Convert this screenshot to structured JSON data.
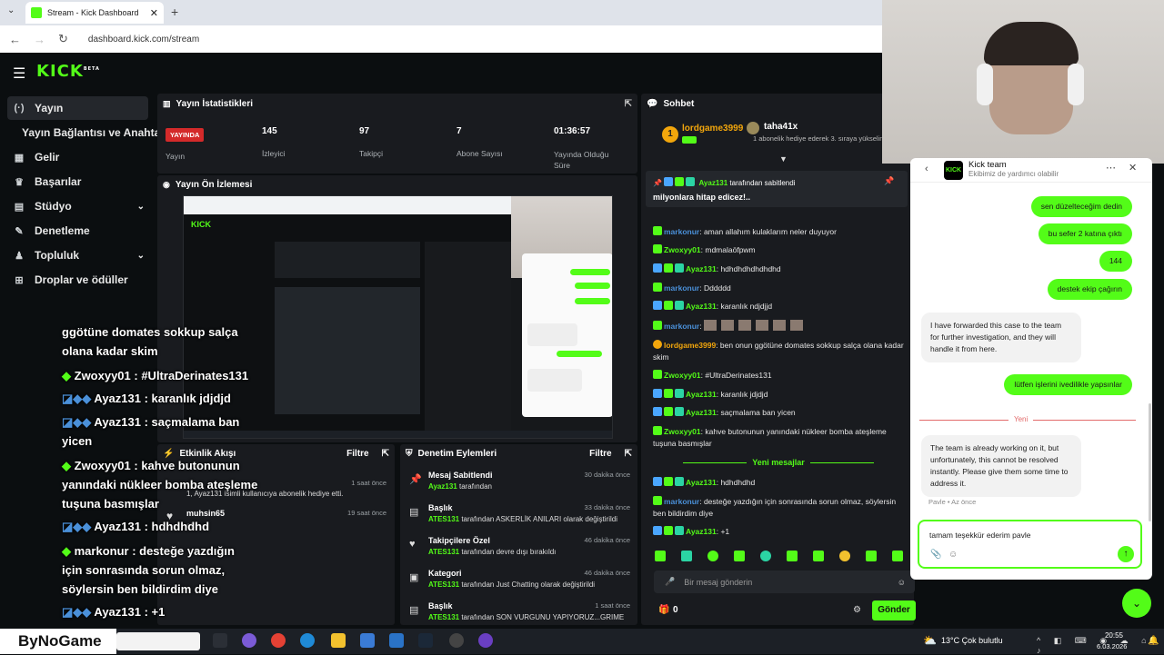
{
  "browser": {
    "tab_title": "Stream - Kick Dashboard",
    "url": "dashboard.kick.com/stream"
  },
  "app": {
    "logo": "KICK",
    "logo_sup": "BETA",
    "nav": [
      {
        "label": "Yayın",
        "icon": "stream-icon",
        "active": true
      },
      {
        "label": "Yayın Bağlantısı ve Anahtarı",
        "icon": ""
      },
      {
        "label": "Gelir",
        "icon": "revenue-icon"
      },
      {
        "label": "Başarılar",
        "icon": "trophy-icon"
      },
      {
        "label": "Stüdyo",
        "icon": "studio-icon",
        "chevron": true
      },
      {
        "label": "Denetleme",
        "icon": "wrench-icon"
      },
      {
        "label": "Topluluk",
        "icon": "community-icon",
        "chevron": true
      },
      {
        "label": "Droplar ve ödüller",
        "icon": "drops-icon"
      }
    ]
  },
  "stats": {
    "title": "Yayın İstatistikleri",
    "live_badge": "YAYINDA",
    "items": [
      {
        "value": "",
        "label": "Yayın"
      },
      {
        "value": "145",
        "label": "İzleyici"
      },
      {
        "value": "97",
        "label": "Takipçi"
      },
      {
        "value": "7",
        "label": "Abone Sayısı"
      },
      {
        "value": "01:36:57",
        "label": "Yayında Olduğu Süre"
      }
    ]
  },
  "preview": {
    "title": "Yayın Ön İzlemesi"
  },
  "activity": {
    "title": "Etkinlik Akışı",
    "filter": "Filtre",
    "items": [
      {
        "text": "1, Ayaz131 isimli kullanıcıya abonelik hediye etti.",
        "time": "1 saat önce"
      },
      {
        "user": "muhsin65",
        "text": "etti",
        "time": "19 saat önce"
      }
    ]
  },
  "modlog": {
    "title": "Denetim Eylemleri",
    "filter": "Filtre",
    "items": [
      {
        "title": "Mesaj Sabitlendi",
        "by": "Ayaz131",
        "rest": "tarafından",
        "time": "30 dakika önce"
      },
      {
        "title": "Başlık",
        "by": "ATES131",
        "rest": "tarafından ASKERLİK ANILARI olarak değiştirildi",
        "time": "33 dakika önce"
      },
      {
        "title": "Takipçilere Özel",
        "by": "ATES131",
        "rest": "tarafından devre dışı bırakıldı",
        "time": "46 dakika önce"
      },
      {
        "title": "Kategori",
        "by": "ATES131",
        "rest": "tarafından Just Chatting olarak değiştirildi",
        "time": "46 dakika önce"
      },
      {
        "title": "Başlık",
        "by": "ATES131",
        "rest": "tarafından SON VURGUNU YAPIYORUZ...GRIME",
        "time": "1 saat önce"
      }
    ]
  },
  "chat": {
    "title": "Sohbet",
    "top_gifter_1": "lordgame3999",
    "top_gifter_2": "taha41x",
    "top_gifter_2_note": "1 abonelik hediye ederek 3. sıraya yükselin",
    "pinned_by": "Ayaz131",
    "pinned_note": "tarafından sabitlendi",
    "pinned_msg": "milyonlara hitap edicez!..",
    "messages": [
      {
        "user": "markonur",
        "text": "aman allahım kulaklarım neler duyuyor"
      },
      {
        "user": "Zwoxyy01",
        "text": "mdmalaöfpwm"
      },
      {
        "user": "Ayaz131",
        "text": "hdhdhdhdhdhdhd"
      },
      {
        "user": "markonur",
        "text": "Dddddd"
      },
      {
        "user": "Ayaz131",
        "text": "karanlık ndjdjjd"
      },
      {
        "user": "markonur",
        "text": ""
      },
      {
        "user": "lordgame3999",
        "text": "ben onun ggötüne domates sokkup salça olana kadar skim"
      },
      {
        "user": "Zwoxyy01",
        "text": "#UltraDerinates131"
      },
      {
        "user": "Ayaz131",
        "text": "karanlık jdjdjd"
      },
      {
        "user": "Ayaz131",
        "text": "saçmalama ban yicen"
      },
      {
        "user": "Zwoxyy01",
        "text": "kahve butonunun yanındaki nükleer bomba ateşleme tuşuna basmışlar"
      },
      {
        "user": "Ayaz131",
        "text": "hdhdhdhd"
      },
      {
        "user": "markonur",
        "text": "desteğe yazdığın için sonrasında sorun olmaz, söylersin ben bildirdim diye"
      },
      {
        "user": "Ayaz131",
        "text": "+1"
      }
    ],
    "new_messages": "Yeni mesajlar",
    "input_placeholder": "Bir mesaj gönderin",
    "points": "0",
    "send": "Gönder"
  },
  "overlay": {
    "lines": [
      "ggötüne domates sokkup salça",
      "olana kadar skim",
      "Zwoxyy01 : #UltraDerinates131",
      "Ayaz131 : karanlık jdjdjd",
      "Ayaz131 : saçmalama ban",
      "yicen",
      "Zwoxyy01 : kahve butonunun",
      "yanındaki nükleer bomba ateşleme",
      "tuşuna basmışlar",
      "Ayaz131 : hdhdhdhd",
      "markonur : desteğe yazdığın",
      "için sonrasında sorun olmaz,",
      "söylersin ben bildirdim diye",
      "Ayaz131 : +1"
    ]
  },
  "support": {
    "title": "Kick team",
    "subtitle": "Ekibimiz de yardımcı olabilir",
    "me": [
      "sen düzelteceğim dedin",
      "bu sefer 2 katına çıktı",
      "144",
      "destek ekip çağırın"
    ],
    "them1": "I have forwarded this case to the team for further investigation, and they will handle it from here.",
    "me2": "lütfen işlerini ivedilikle yapsınlar",
    "divider": "Yeni",
    "them2": "The team is already working on it, but unfortunately, this cannot be resolved instantly. Please give them some time to address it.",
    "sender": "Pavle • Az önce",
    "draft": "tamam teşekkür ederim pavle"
  },
  "taskbar": {
    "brand": "ByNoGame",
    "weather": "13°C  Çok bulutlu",
    "time": "20:55",
    "date": "6.03.2026"
  }
}
